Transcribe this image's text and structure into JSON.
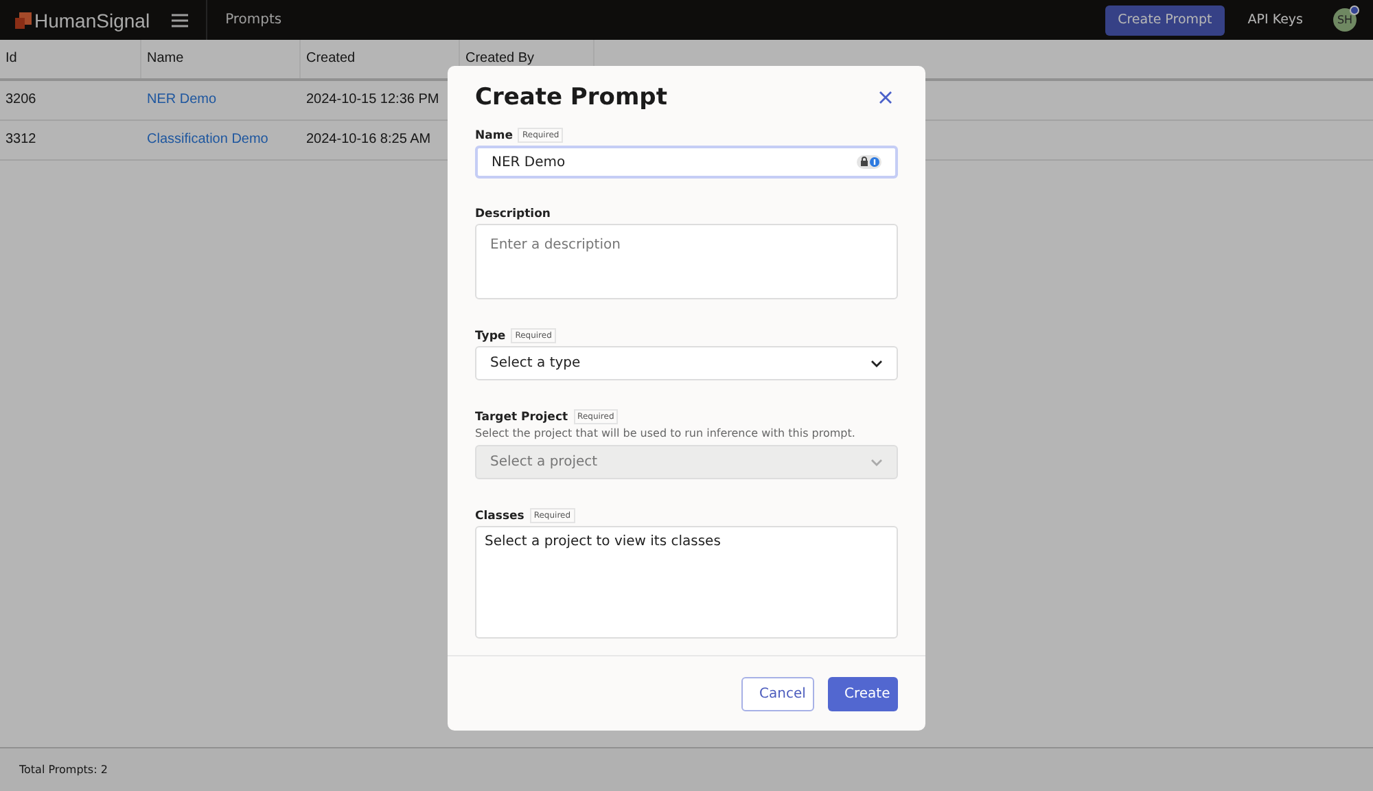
{
  "topbar": {
    "logo": "HumanSignal",
    "section": "Prompts",
    "primary_button": "Create Prompt",
    "link": "API Keys",
    "avatar": "SH",
    "notification": true
  },
  "table": {
    "columns": [
      "Id",
      "Name",
      "Created",
      "Created By"
    ],
    "rows": [
      {
        "id": "3206",
        "name": "NER Demo",
        "created": "2024-10-15 12:36 PM"
      },
      {
        "id": "3312",
        "name": "Classification Demo",
        "created": "2024-10-16 8:25 AM"
      }
    ]
  },
  "footer": "Total Prompts: 2",
  "modal": {
    "title": "Create Prompt",
    "fields": [
      {
        "kind": "text",
        "label": "Name",
        "required": "Required",
        "value": "NER Demo",
        "focused": true
      },
      {
        "kind": "textarea",
        "label": "Description",
        "placeholder": "Enter a description"
      },
      {
        "kind": "select",
        "label": "Type",
        "required": "Required",
        "value": "Select a type",
        "disabled": false
      },
      {
        "kind": "select",
        "label": "Target Project",
        "required": "Required",
        "help": "Select the project that will be used to run inference with this prompt.",
        "placeholder": "Select a project",
        "disabled": true
      },
      {
        "kind": "box",
        "label": "Classes",
        "required": "Required",
        "value": "Select a project to view its classes"
      }
    ],
    "buttons": {
      "cancel": "Cancel",
      "submit": "Create"
    }
  }
}
